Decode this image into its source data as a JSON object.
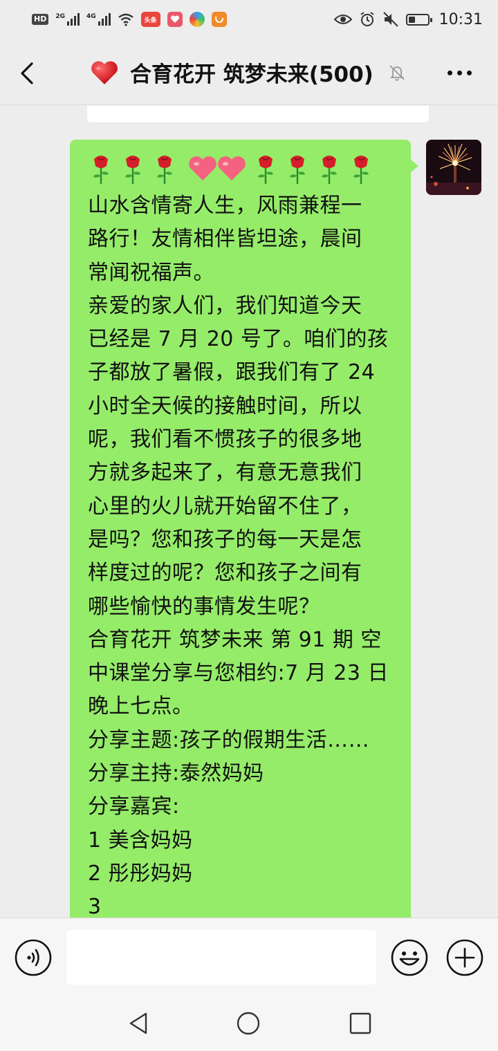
{
  "status_bar": {
    "hd": "HD",
    "net1": "2G",
    "net2": "4G",
    "app1": "头条",
    "battery_level": 0.3,
    "time": "10:31"
  },
  "header": {
    "title": "合育花开 筑梦未来(500)",
    "title_emoji": "heart-icon",
    "muted": true
  },
  "message": {
    "emoji_line": [
      "rose",
      "rose",
      "rose",
      "heart",
      "heart",
      "rose",
      "rose",
      "rose",
      "rose"
    ],
    "text": "山水含情寄人生，风雨兼程一\n路行！友情相伴皆坦途，晨间\n常闻祝福声。\n亲爱的家人们，我们知道今天\n已经是 7 月 20 号了。咱们的孩\n子都放了暑假，跟我们有了 24\n小时全天候的接触时间，所以\n呢，我们看不惯孩子的很多地\n方就多起来了，有意无意我们\n心里的火儿就开始留不住了，\n是吗？您和孩子的每一天是怎\n样度过的呢？您和孩子之间有\n哪些愉快的事情发生呢？\n合育花开 筑梦未来 第 91 期 空\n中课堂分享与您相约:7 月 23 日\n晚上七点。\n分享主题:孩子的假期生活……\n分享主持:泰然妈妈\n分享嘉宾:\n1 美含妈妈\n2 彤彤妈妈\n3"
  },
  "colors": {
    "bubble": "#95ec69",
    "background": "#ededed"
  }
}
